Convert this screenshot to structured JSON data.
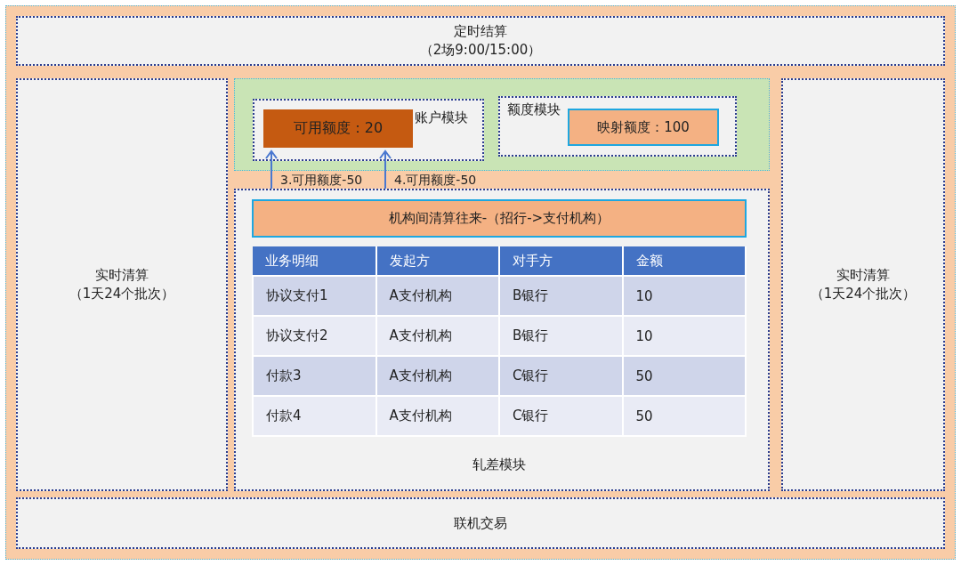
{
  "top_panel": {
    "title": "定时结算",
    "subtitle": "（2场9:00/15:00）"
  },
  "left_panel": {
    "title": "实时清算",
    "subtitle": "（1天24个批次）"
  },
  "account_module": {
    "label": "账户模块",
    "balance": "可用额度：20"
  },
  "quota_module": {
    "label": "额度模块",
    "mapped": "映射额度：100"
  },
  "arrow_labels": [
    "3.可用额度-50",
    "4.可用额度-50"
  ],
  "netting_module": {
    "banner": "机构间清算往来-（招行->支付机构）",
    "table": {
      "columns": [
        "业务明细",
        "发起方",
        "对手方",
        "金额"
      ],
      "rows": [
        [
          "协议支付1",
          "A支付机构",
          "B银行",
          "10"
        ],
        [
          "协议支付2",
          "A支付机构",
          "B银行",
          "10"
        ],
        [
          "付款3",
          "A支付机构",
          "C银行",
          "50"
        ],
        [
          "付款4",
          "A支付机构",
          "C银行",
          "50"
        ]
      ]
    },
    "label": "轧差模块"
  },
  "right_panel": {
    "title": "实时清算",
    "subtitle": "（1天24个批次）"
  },
  "bottom_panel": {
    "title": "联机交易"
  }
}
